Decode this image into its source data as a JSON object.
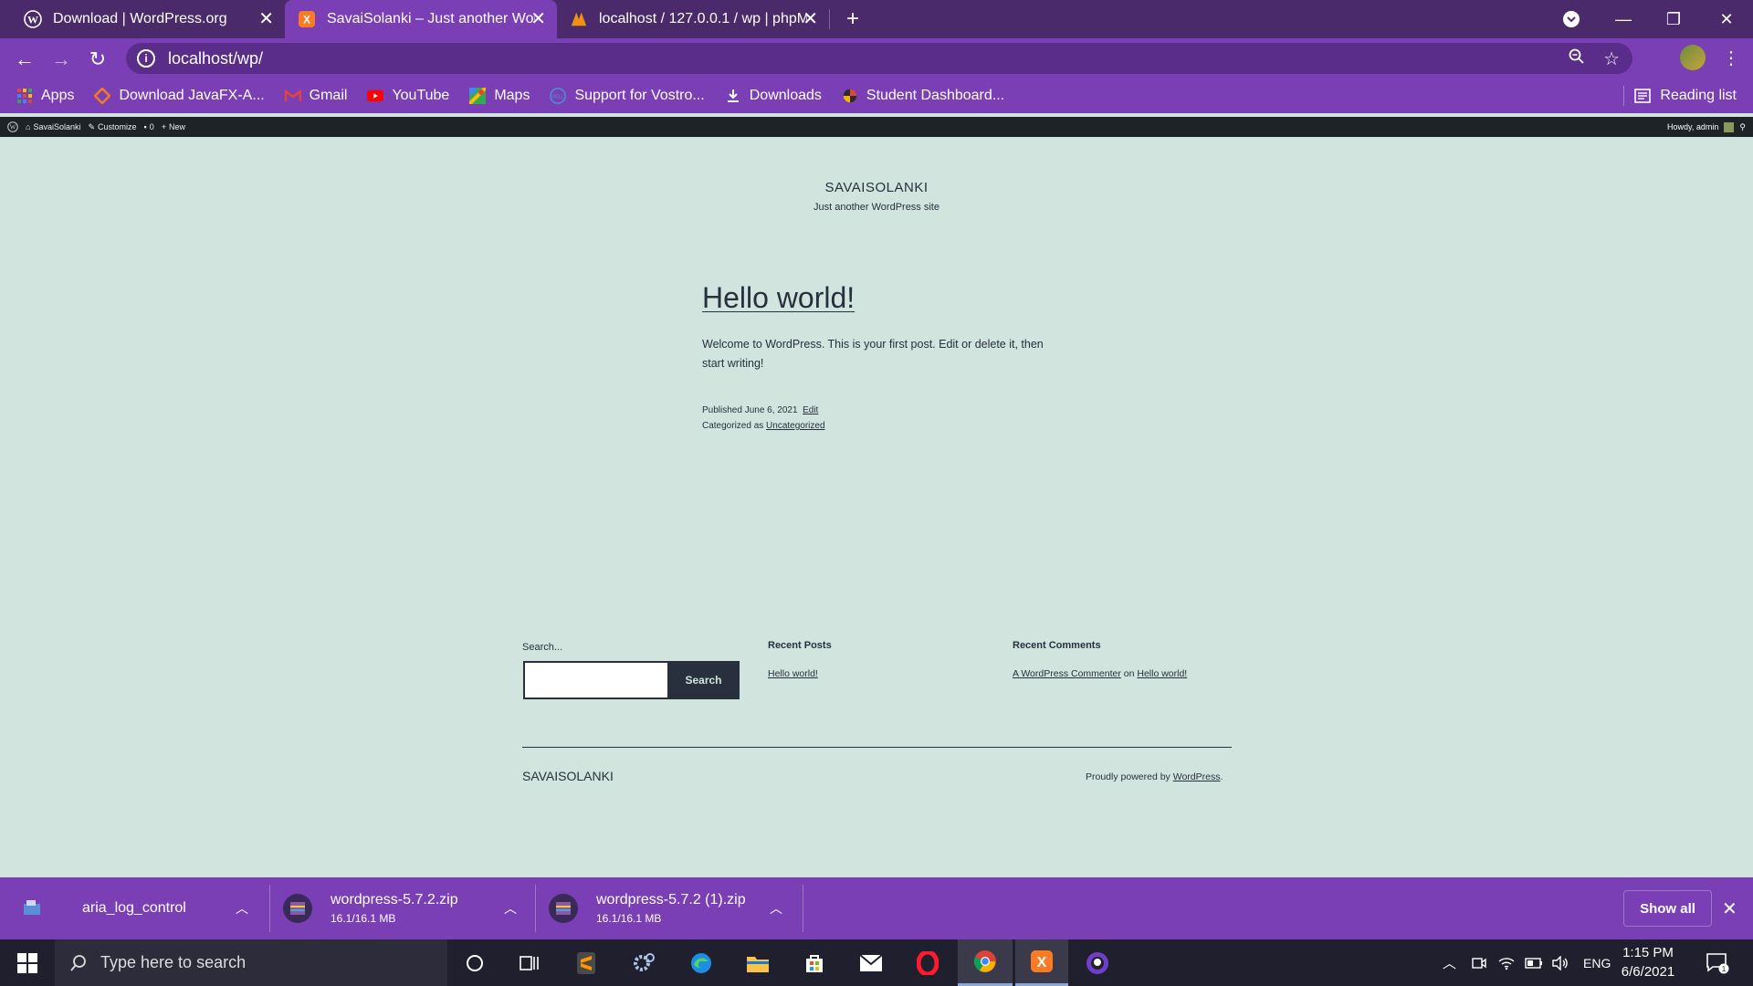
{
  "browser": {
    "tabs": [
      {
        "title": "Download | WordPress.org",
        "icon": "wordpress-icon",
        "active": false
      },
      {
        "title": "SavaiSolanki – Just another WordPress site",
        "icon": "xampp-icon",
        "active": true
      },
      {
        "title": "localhost / 127.0.0.1 / wp | phpMyAdmin",
        "icon": "phpmyadmin-icon",
        "active": false
      }
    ],
    "url": "localhost/wp/",
    "bookmarks": [
      {
        "label": "Apps",
        "icon": "apps-grid-icon"
      },
      {
        "label": "Download JavaFX-A...",
        "icon": "javafx-icon"
      },
      {
        "label": "Gmail",
        "icon": "gmail-icon"
      },
      {
        "label": "YouTube",
        "icon": "youtube-icon"
      },
      {
        "label": "Maps",
        "icon": "maps-icon"
      },
      {
        "label": "Support for Vostro...",
        "icon": "dell-icon"
      },
      {
        "label": "Downloads",
        "icon": "download-icon"
      },
      {
        "label": "Student Dashboard...",
        "icon": "student-icon"
      }
    ],
    "reading_list": "Reading list"
  },
  "adminbar": {
    "site": "SavaiSolanki",
    "customize": "Customize",
    "comments": "0",
    "new": "New",
    "howdy": "Howdy, admin"
  },
  "site": {
    "title": "SAVAISOLANKI",
    "description": "Just another WordPress site"
  },
  "post": {
    "title": "Hello world!",
    "body": "Welcome to WordPress. This is your first post. Edit or delete it, then start writing!",
    "published_label": "Published",
    "date": "June 6, 2021",
    "edit": "Edit",
    "categorized_label": "Categorized as",
    "category": "Uncategorized"
  },
  "widgets": {
    "search_label": "Search...",
    "search_button": "Search",
    "recent_posts_heading": "Recent Posts",
    "recent_post": "Hello world!",
    "recent_comments_heading": "Recent Comments",
    "commenter": "A WordPress Commenter",
    "on": "on",
    "comment_post": "Hello world!"
  },
  "footer": {
    "title": "SAVAISOLANKI",
    "powered_prefix": "Proudly powered by",
    "powered_link": "WordPress",
    "powered_suffix": "."
  },
  "downloads": [
    {
      "name": "aria_log_control",
      "size": ""
    },
    {
      "name": "wordpress-5.7.2.zip",
      "size": "16.1/16.1 MB"
    },
    {
      "name": "wordpress-5.7.2 (1).zip",
      "size": "16.1/16.1 MB"
    }
  ],
  "show_all": "Show all",
  "taskbar": {
    "search_placeholder": "Type here to search",
    "lang": "ENG",
    "time": "1:15 PM",
    "date": "6/6/2021",
    "notifications": "1"
  },
  "colors": {
    "page_bg": "#d1e4dd",
    "text": "#28303d",
    "browser_frame": "#7b3fb5",
    "tabstrip": "#4b2a6b"
  }
}
